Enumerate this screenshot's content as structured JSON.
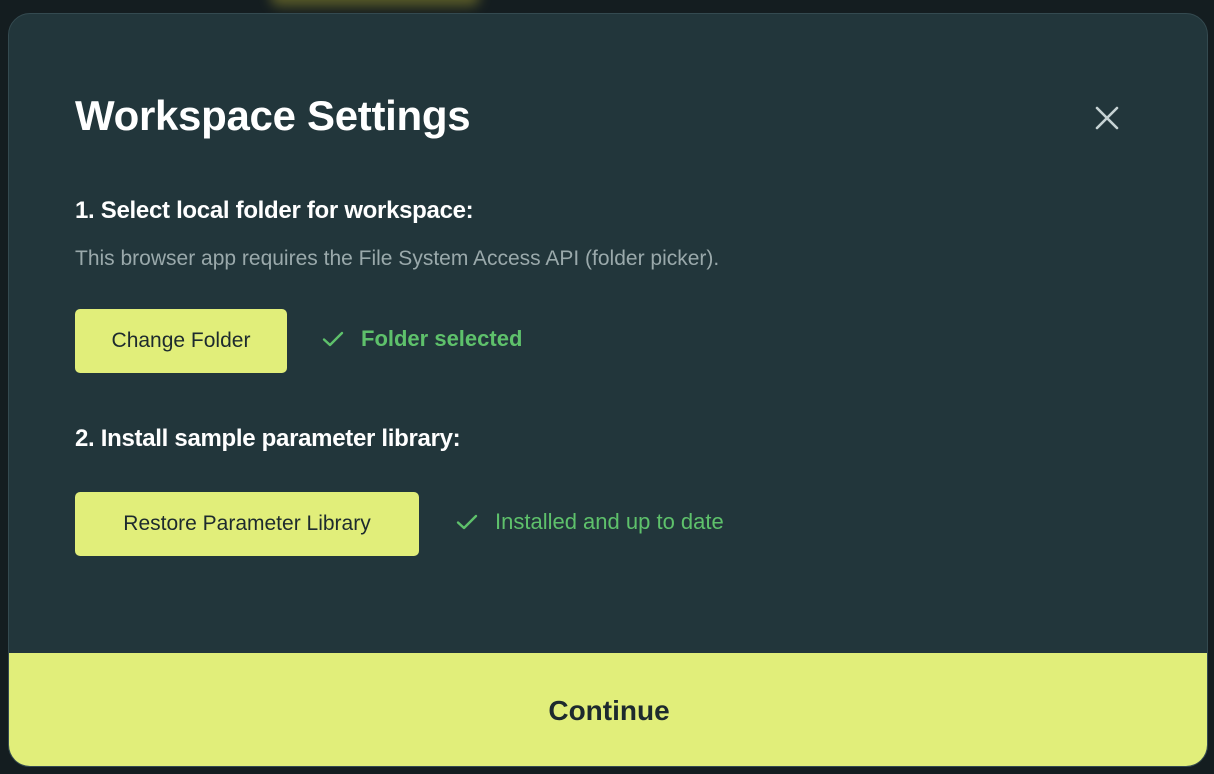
{
  "dialog": {
    "title": "Workspace Settings",
    "close_icon": "close-icon"
  },
  "step1": {
    "heading": "1. Select local folder for workspace:",
    "description": "This browser app requires the File System Access API (folder picker).",
    "button_label": "Change Folder",
    "status_icon": "check-icon",
    "status_text": "Folder selected"
  },
  "step2": {
    "heading": "2. Install sample parameter library:",
    "button_label": "Restore Parameter Library",
    "status_icon": "check-icon",
    "status_text": "Installed and up to date"
  },
  "footer": {
    "continue_label": "Continue"
  },
  "colors": {
    "accent": "#e1ee7a",
    "dialog_bg": "#22363b",
    "success": "#5ec16b"
  }
}
